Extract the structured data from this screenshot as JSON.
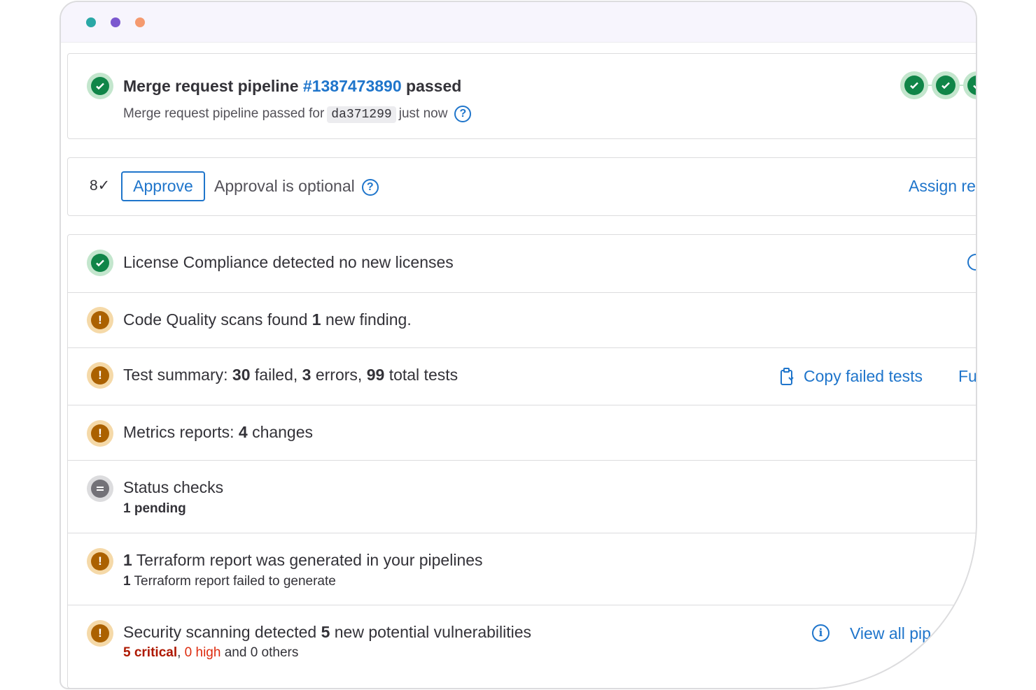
{
  "pipeline": {
    "title_prefix": "Merge request pipeline",
    "pipeline_id": "#1387473890",
    "title_suffix": "passed",
    "subtitle_prefix": "Merge request pipeline passed for",
    "commit_sha": "da371299",
    "subtitle_suffix": "just now",
    "help_glyph": "?"
  },
  "approval": {
    "approvals_icon": "8✓",
    "approve_label": "Approve",
    "optional_text": "Approval is optional",
    "help_glyph": "?",
    "assign_link": "Assign re"
  },
  "reports": {
    "license": {
      "text": "License Compliance detected no new licenses"
    },
    "code_quality": {
      "prefix": "Code Quality scans found",
      "count": "1",
      "suffix": "new finding."
    },
    "tests": {
      "label": "Test summary:",
      "failed": "30",
      "failed_label": "failed,",
      "errors": "3",
      "errors_label": "errors,",
      "total": "99",
      "total_label": "total tests",
      "copy_label": "Copy failed tests",
      "full_report": "Fu"
    },
    "metrics": {
      "label": "Metrics reports:",
      "count": "4",
      "suffix": "changes"
    },
    "status_checks": {
      "title": "Status checks",
      "pending": "1 pending"
    },
    "terraform": {
      "count": "1",
      "title_suffix": "Terraform report was generated in your pipelines",
      "sub_count": "1",
      "sub_suffix": "Terraform report failed to generate"
    },
    "security": {
      "prefix": "Security scanning detected",
      "count": "5",
      "suffix": "new potential vulnerabilities",
      "critical": "5 critical",
      "sep": ",",
      "high": "0 high",
      "others": "and 0 others",
      "view_all": "View all pip"
    }
  },
  "colors": {
    "success": "#108548",
    "warning": "#ab6100",
    "link": "#1f75cb",
    "critical": "#ae1800",
    "dot_teal": "#2aa8a6",
    "dot_purple": "#7b58cf",
    "dot_orange": "#f59a6f"
  }
}
